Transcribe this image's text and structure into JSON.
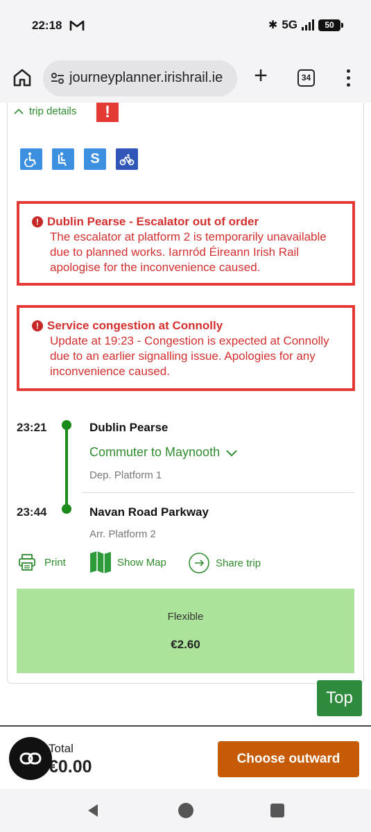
{
  "status": {
    "time": "22:18",
    "network": "5G",
    "battery": "50"
  },
  "browser": {
    "url": "journeyplanner.irishrail.ie",
    "tab_count": "34",
    "plus": "+"
  },
  "trip": {
    "details_toggle": "trip details",
    "alert_glyph": "!",
    "amenities": [
      {
        "icon": "wheelchair-icon",
        "label": "♿"
      },
      {
        "icon": "seated-passenger-icon",
        "label": "⑂"
      },
      {
        "icon": "s-service-icon",
        "label": "S"
      },
      {
        "icon": "bicycle-icon",
        "label": "♲"
      }
    ],
    "notices": [
      {
        "title": "Dublin Pearse - Escalator out of order",
        "body": "The escalator at platform 2 is temporarily unavailable due to planned works. Iarnród Éireann Irish Rail apologise for the inconvenience caused."
      },
      {
        "title": "Service congestion at Connolly",
        "body": "Update at 19:23 - Congestion is expected at Connolly due to an earlier signalling issue. Apologies for any inconvenience caused."
      }
    ],
    "departure": {
      "time": "23:21",
      "station": "Dublin Pearse",
      "platform": "Dep. Platform 1"
    },
    "service": "Commuter to Maynooth",
    "arrival": {
      "time": "23:44",
      "station": "Navan Road Parkway",
      "platform": "Arr. Platform 2"
    },
    "actions": {
      "print": "Print",
      "show_map": "Show Map",
      "share": "Share trip"
    },
    "fare": {
      "type": "Flexible",
      "price": "€2.60"
    },
    "top_button": "Top"
  },
  "bottom": {
    "total_label": "Total",
    "total_amount": "€0.00",
    "choose_button": "Choose outward"
  },
  "colors": {
    "accent_green": "#2e8b2e",
    "alert_red": "#e53935",
    "fare_green": "#abe39a",
    "cta_orange": "#c65b05"
  }
}
